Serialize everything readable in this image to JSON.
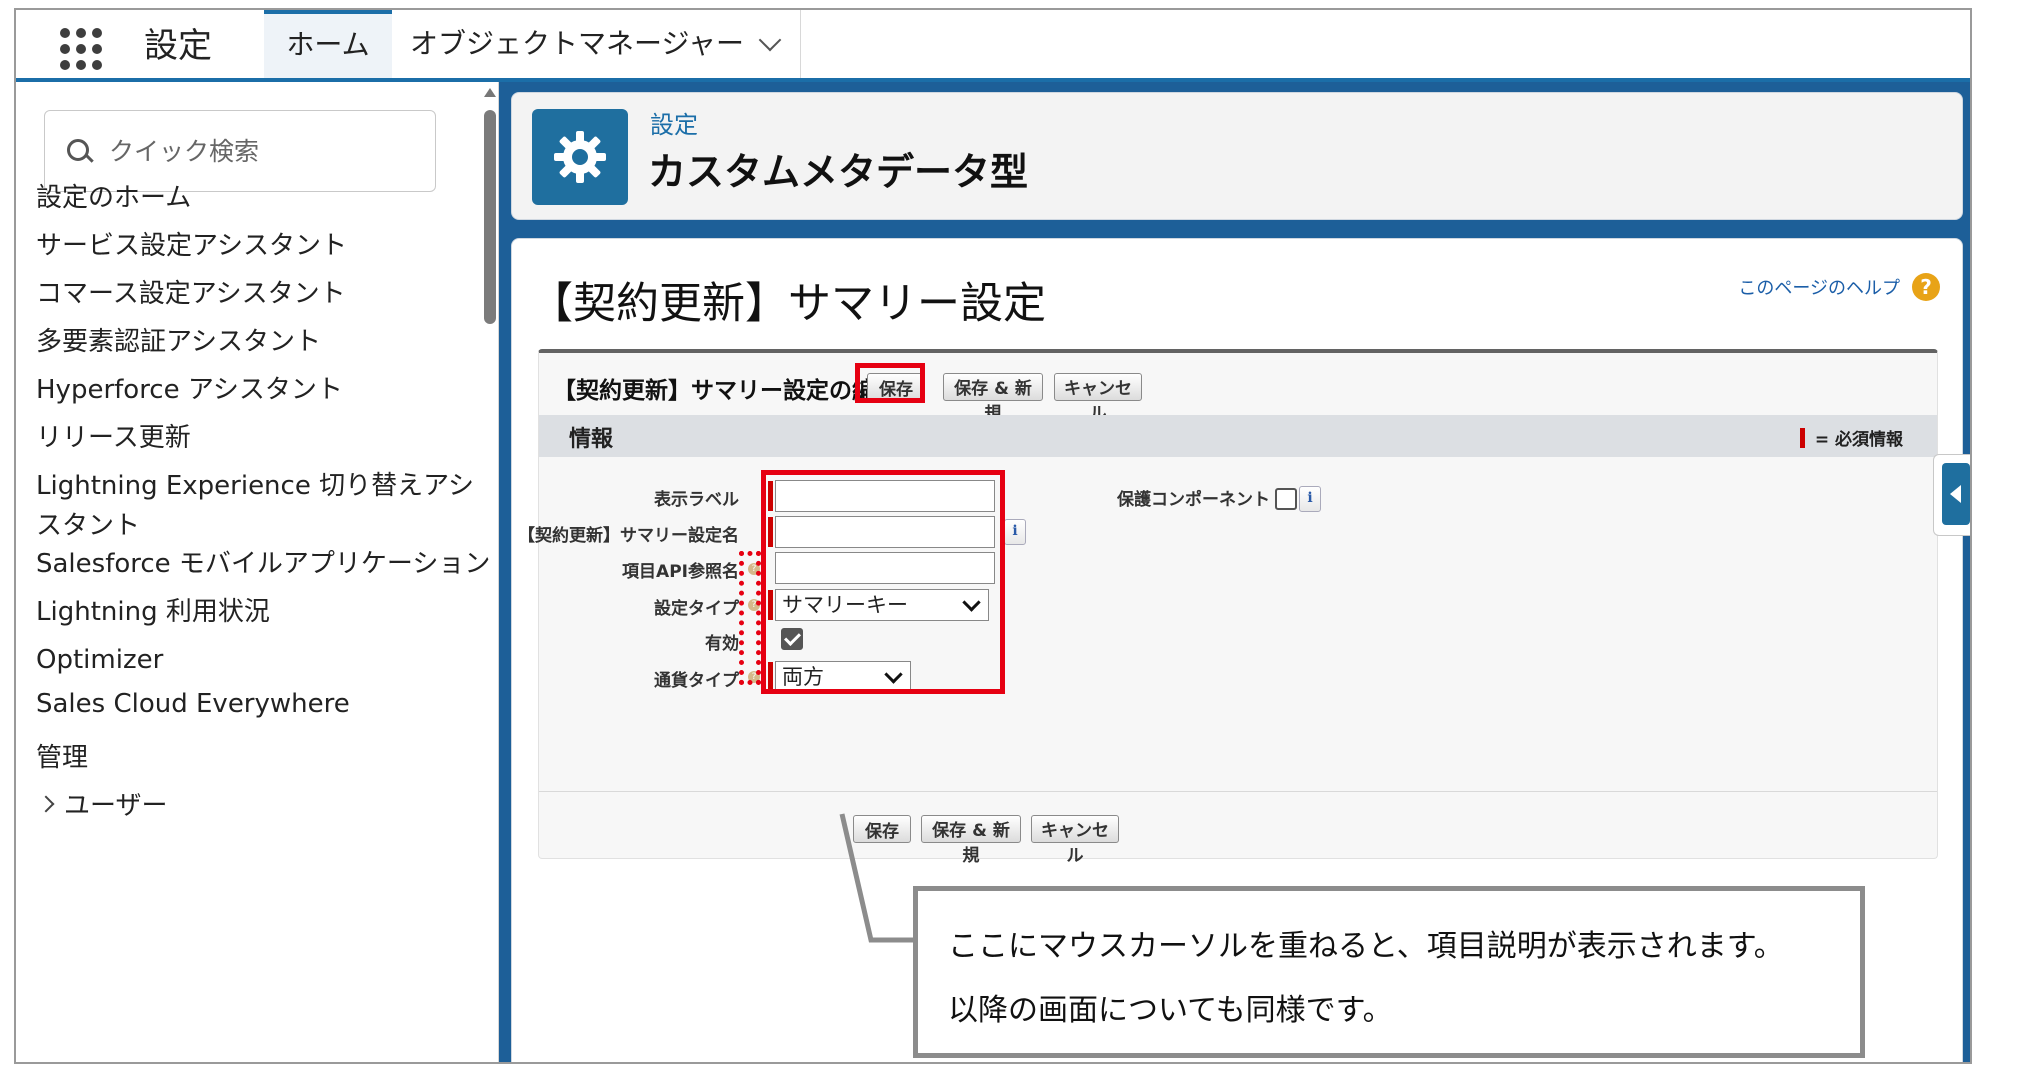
{
  "topbar": {
    "app_launcher_icon": "app-launcher-icon",
    "app_title": "設定",
    "tabs": [
      {
        "label": "ホーム"
      },
      {
        "label": "オブジェクトマネージャー"
      }
    ]
  },
  "sidebar": {
    "search": {
      "placeholder": "クイック検索"
    },
    "items": [
      {
        "label": "設定のホーム"
      },
      {
        "label": "サービス設定アシスタント"
      },
      {
        "label": "コマース設定アシスタント"
      },
      {
        "label": "多要素認証アシスタント"
      },
      {
        "label": "Hyperforce アシスタント"
      },
      {
        "label": "リリース更新"
      },
      {
        "label": "Lightning Experience 切り替えアシスタント"
      },
      {
        "label": "Salesforce モバイルアプリケーション"
      },
      {
        "label": "Lightning 利用状況"
      },
      {
        "label": "Optimizer"
      },
      {
        "label": "Sales Cloud Everywhere"
      }
    ],
    "section_admin": "管理",
    "section_users": "ユーザー"
  },
  "header": {
    "eyebrow": "設定",
    "title": "カスタムメタデータ型",
    "icon": "gear-icon"
  },
  "page": {
    "title": "【契約更新】サマリー設定",
    "help_link": "このページのヘルプ",
    "help_icon": "?"
  },
  "edit": {
    "title": "【契約更新】サマリー設定の編集",
    "buttons": {
      "save": "保存",
      "save_new": "保存 & 新規",
      "cancel": "キャンセル"
    },
    "section": "情報",
    "required_legend": "= 必須情報",
    "fields": {
      "label": {
        "label": "表示ラベル",
        "value": ""
      },
      "name": {
        "label": "【契約更新】サマリー設定名",
        "value": ""
      },
      "api": {
        "label": "項目API参照名",
        "value": ""
      },
      "type": {
        "label": "設定タイプ",
        "value": "サマリーキー"
      },
      "active": {
        "label": "有効",
        "checked": true
      },
      "currency": {
        "label": "通貨タイプ",
        "value": "両方"
      },
      "protected": {
        "label": "保護コンポーネント",
        "checked": false
      }
    },
    "info_icon": "i",
    "help_dot": "?"
  },
  "callout": {
    "line1": "ここにマウスカーソルを重ねると、項目説明が表示されます。",
    "line2": "以降の画面についても同様です。"
  },
  "colors": {
    "accent": "#1b6ea8",
    "highlight": "#e60012",
    "required": "#cc0000"
  }
}
